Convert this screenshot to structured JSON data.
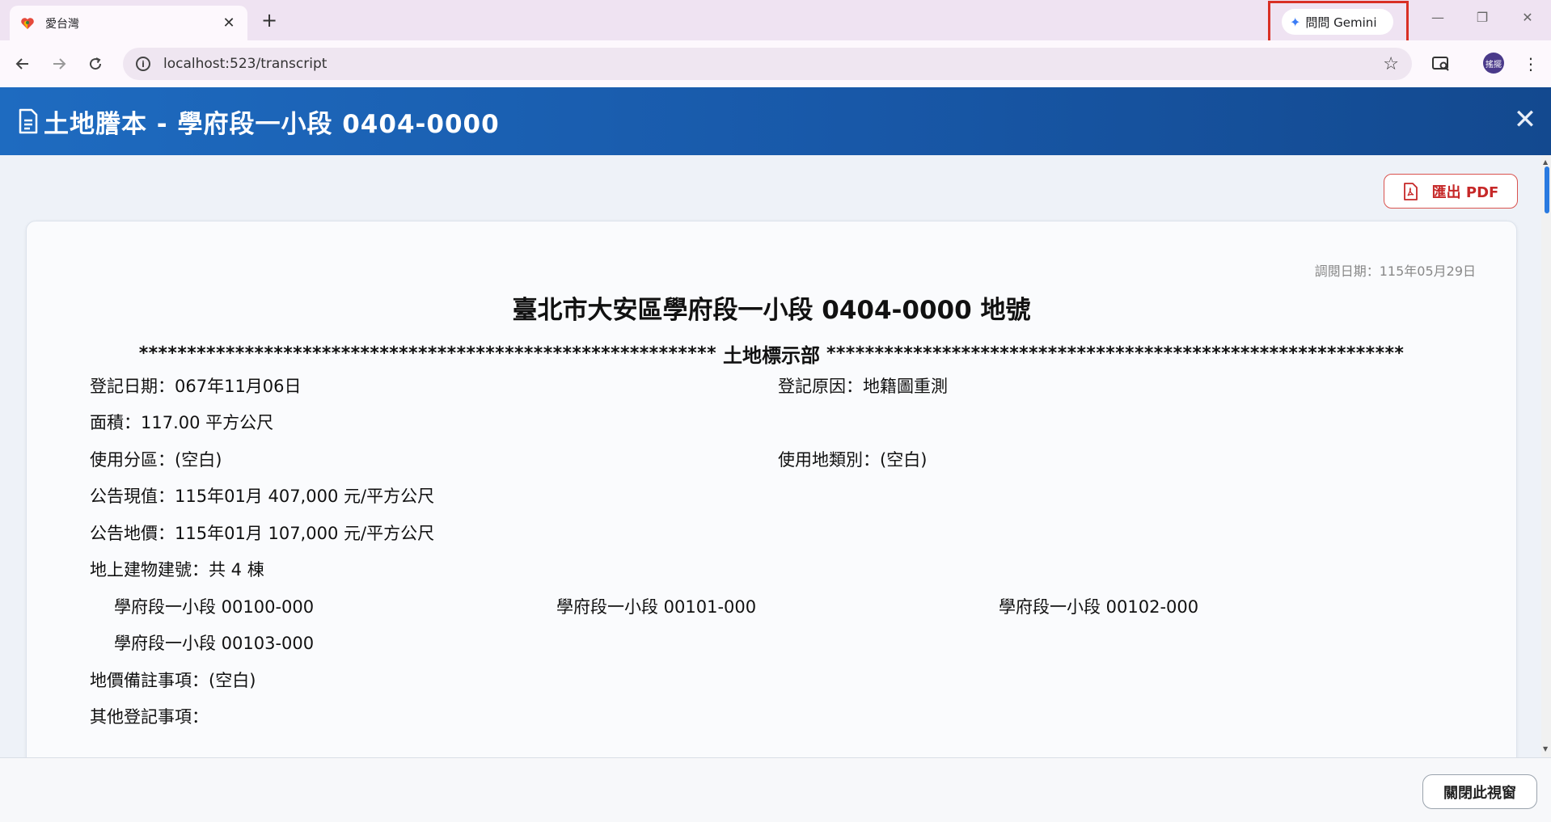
{
  "browser": {
    "tab_title": "愛台灣",
    "tab_close": "✕",
    "new_tab": "+",
    "gemini_label": "問問 Gemini",
    "url": "localhost:523/transcript",
    "avatar_text": "搖擺",
    "window_controls": {
      "minimize": "—",
      "restore": "❐",
      "close": "✕"
    }
  },
  "header": {
    "title": "土地謄本 - 學府段一小段 0404-0000",
    "close_icon": "✕"
  },
  "toolbar": {
    "export_label": "匯出 PDF"
  },
  "document": {
    "print_date": "調閱日期：115年05月29日",
    "title": "臺北市大安區學府段一小段 0404-0000 地號",
    "section_stars": "************************************************************",
    "section_label": "土地標示部",
    "fields": {
      "reg_date": "登記日期：067年11月06日",
      "reg_reason": "登記原因：地籍圖重測",
      "area": "面積：117.00 平方公尺",
      "zoning": "使用分區：(空白)",
      "land_use": "使用地類別：(空白)",
      "announced_value": "公告現值：115年01月 407,000 元/平方公尺",
      "announced_price": "公告地價：115年01月 107,000 元/平方公尺",
      "buildings_header": "地上建物建號：共 4 棟",
      "buildings": [
        "學府段一小段 00100-000",
        "學府段一小段 00101-000",
        "學府段一小段 00102-000",
        "學府段一小段 00103-000"
      ],
      "price_notes": "地價備註事項：(空白)",
      "other_items": "其他登記事項："
    }
  },
  "footer": {
    "close_window_label": "關閉此視窗"
  }
}
